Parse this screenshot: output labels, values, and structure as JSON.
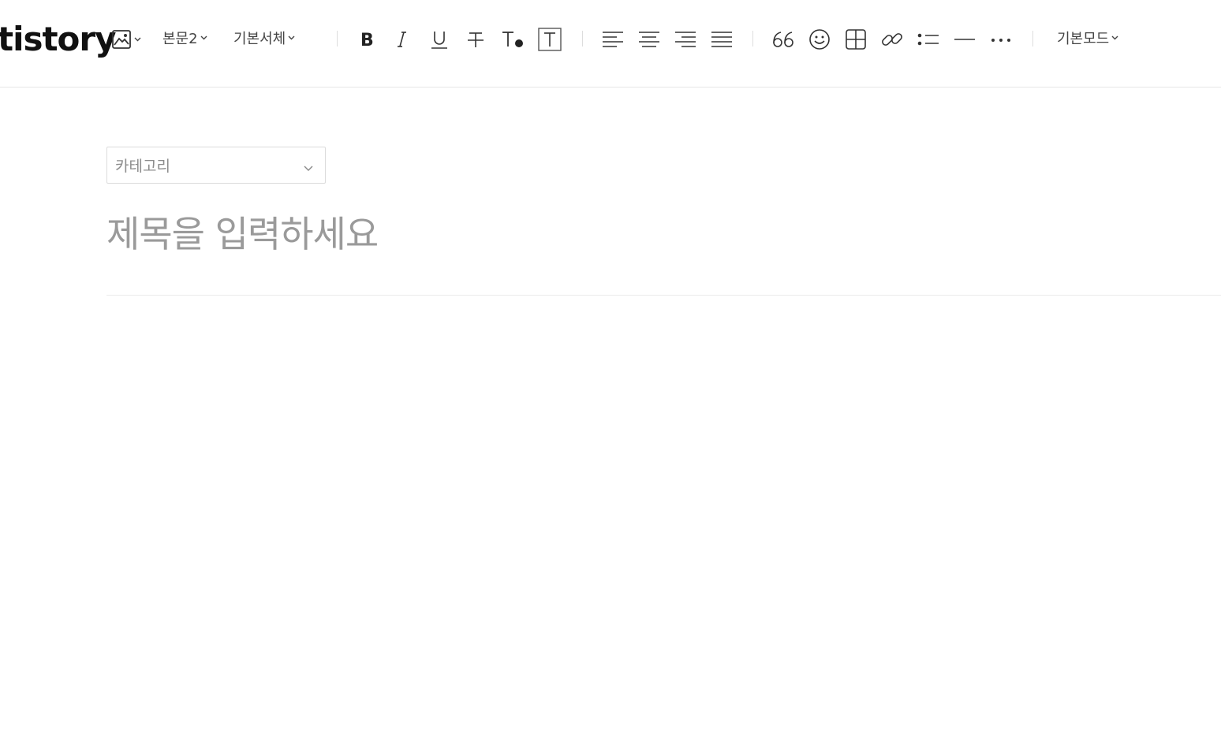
{
  "app": {
    "logo_text": "tistory"
  },
  "toolbar": {
    "image_button": {
      "icon": "image-icon"
    },
    "paragraph_style": {
      "label": "본문2"
    },
    "font_family": {
      "label": "기본서체"
    },
    "format_buttons": [
      {
        "name": "bold",
        "icon": "bold-icon"
      },
      {
        "name": "italic",
        "icon": "italic-icon"
      },
      {
        "name": "underline",
        "icon": "underline-icon"
      },
      {
        "name": "strikethrough",
        "icon": "strikethrough-icon"
      },
      {
        "name": "text-color",
        "icon": "text-color-icon"
      },
      {
        "name": "text-background",
        "icon": "text-background-icon"
      }
    ],
    "align_buttons": [
      {
        "name": "align-left",
        "icon": "align-left-icon"
      },
      {
        "name": "align-center",
        "icon": "align-center-icon"
      },
      {
        "name": "align-right",
        "icon": "align-right-icon"
      },
      {
        "name": "align-justify",
        "icon": "align-justify-icon"
      }
    ],
    "insert_buttons": [
      {
        "name": "quote",
        "icon": "quote-icon"
      },
      {
        "name": "emoticon",
        "icon": "emoticon-icon"
      },
      {
        "name": "table",
        "icon": "table-icon"
      },
      {
        "name": "link",
        "icon": "link-icon"
      },
      {
        "name": "list",
        "icon": "list-icon"
      },
      {
        "name": "horizontal-rule",
        "icon": "horizontal-rule-icon"
      },
      {
        "name": "more",
        "icon": "more-icon"
      }
    ],
    "mode": {
      "label": "기본모드"
    }
  },
  "editor": {
    "category": {
      "placeholder": "카테고리"
    },
    "title": {
      "placeholder": "제목을 입력하세요",
      "value": ""
    }
  }
}
